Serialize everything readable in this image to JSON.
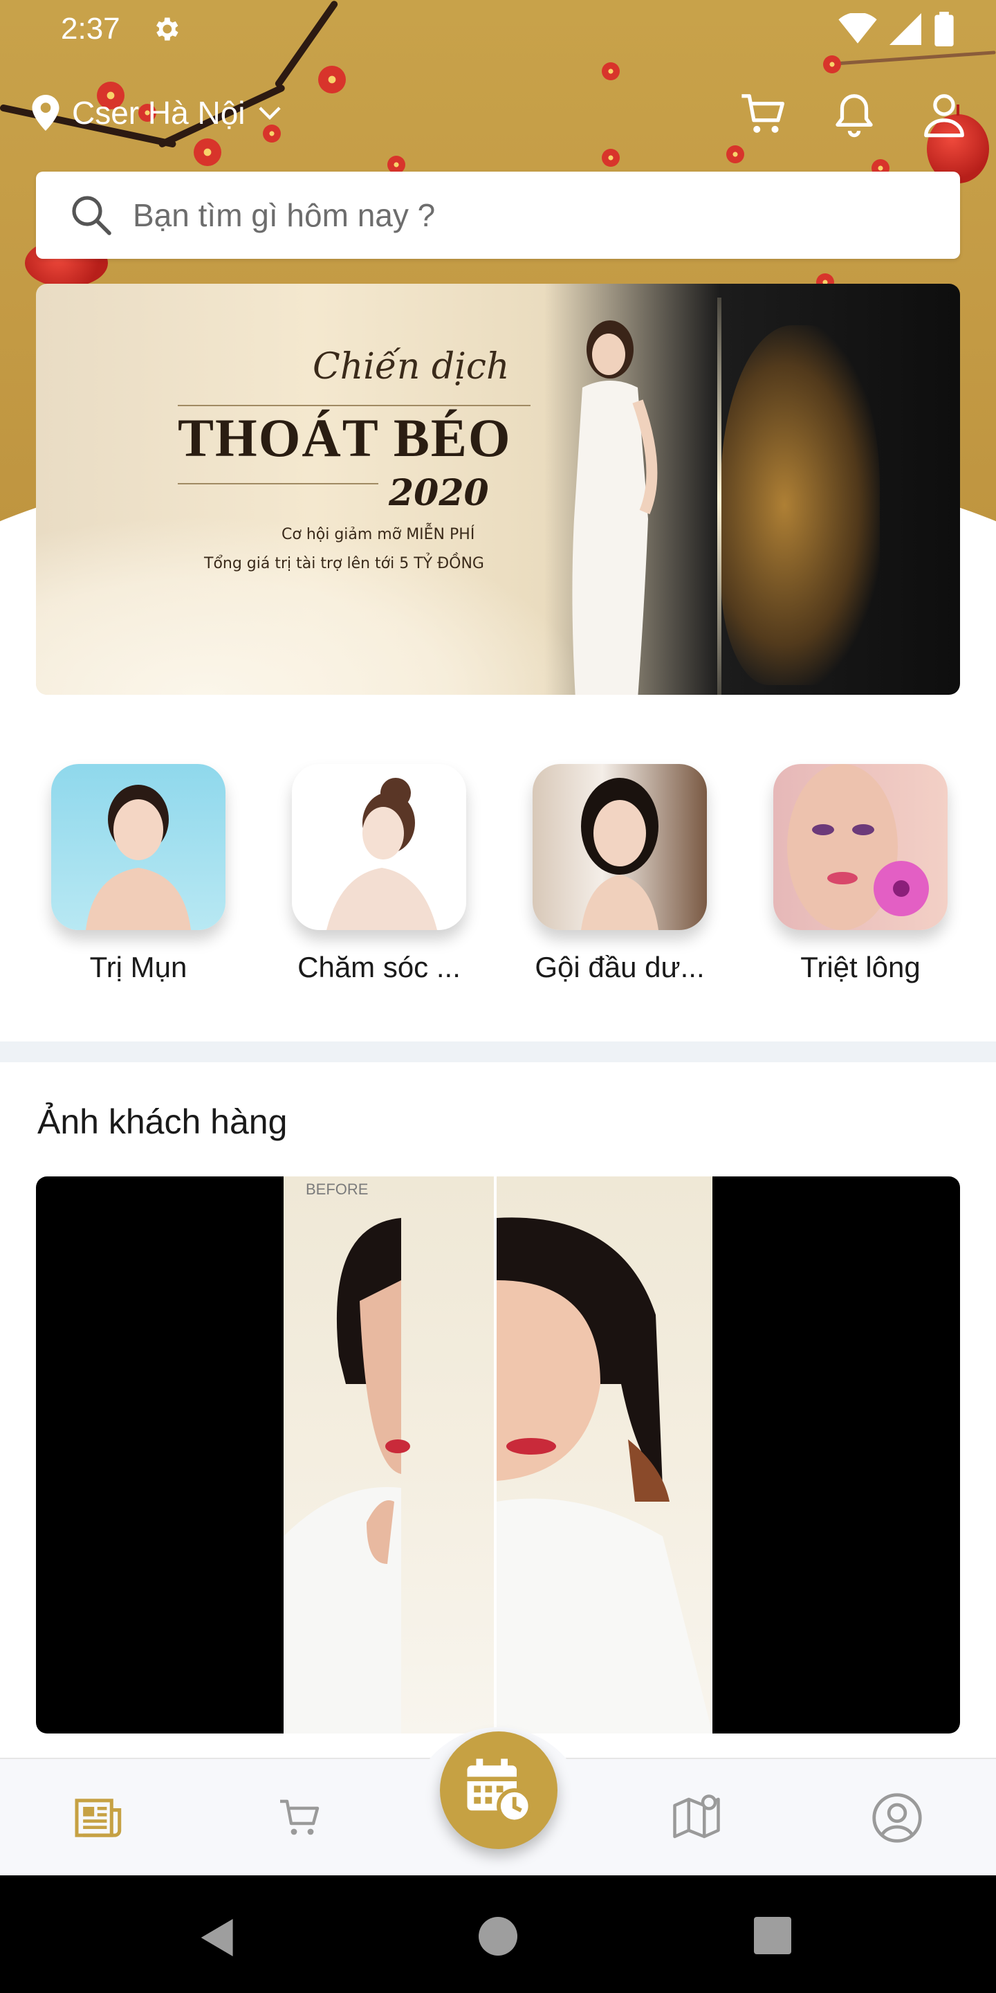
{
  "status_bar": {
    "time": "2:37"
  },
  "header": {
    "location_label": "Cser Hà Nội",
    "icons": [
      "map-pin-icon",
      "cart-icon",
      "bell-icon",
      "user-icon"
    ]
  },
  "search": {
    "placeholder": "Bạn tìm gì hôm nay ?"
  },
  "banner": {
    "title_line1": "Chiến dịch",
    "title_line2": "THOÁT BÉO",
    "title_line3": "2020",
    "text_line1": "Cơ hội giảm mỡ MIỄN PHÍ",
    "text_line2": "Tổng giá trị tài trợ lên tới 5 TỶ ĐỒNG"
  },
  "categories": [
    {
      "label": "Trị Mụn"
    },
    {
      "label": "Chăm sóc ..."
    },
    {
      "label": "Gội đầu dư..."
    },
    {
      "label": "Triệt lông"
    }
  ],
  "customer_photos": {
    "title": "Ảnh khách hàng",
    "before_label": "BEFORE"
  },
  "bottom_nav": {
    "items": [
      "news-icon",
      "cart-icon",
      "calendar-clock-icon",
      "map-icon",
      "account-icon"
    ],
    "active_color": "#c6a143",
    "inactive_color": "#9a9a9a"
  },
  "theme": {
    "header_gold": "#c49b45",
    "accent_gold": "#c6a143",
    "blossom_red": "#d8342b"
  }
}
